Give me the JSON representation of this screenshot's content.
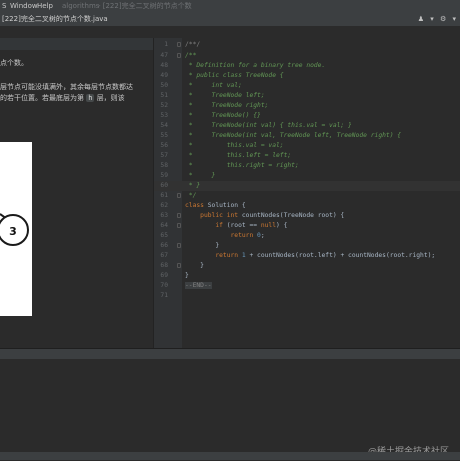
{
  "menubar": {
    "left_glyph": "S",
    "items": [
      "Window",
      "Help"
    ],
    "app_name": "algorithms",
    "window_title": "- [222]完全二叉树的节点个数"
  },
  "tabbar": {
    "file_tab": "[222]完全二叉树的节点个数.java",
    "right_icons": [
      "run-config",
      "▾",
      "⚙",
      "▾"
    ]
  },
  "left_panel": {
    "lines": [
      "点个数。",
      "层节点可能没填满外，其余每层节点数都达",
      "的若干位置。若最底层为第",
      "层，则该"
    ],
    "inline_code": "h",
    "tree_node_value": "3"
  },
  "editor": {
    "line_numbers": [
      "1",
      "47",
      "48",
      "49",
      "50",
      "51",
      "52",
      "53",
      "54",
      "55",
      "56",
      "57",
      "58",
      "59",
      "60",
      "61",
      "62",
      "63",
      "64",
      "65",
      "66",
      "67",
      "68",
      "69",
      "70",
      "71"
    ],
    "code": {
      "l1": "/**/",
      "l47": "/**",
      "l48": " * Definition for a binary tree node.",
      "l49": " * public class TreeNode {",
      "l50": " *     int val;",
      "l51": " *     TreeNode left;",
      "l52": " *     TreeNode right;",
      "l53": " *     TreeNode() {}",
      "l54": " *     TreeNode(int val) { this.val = val; }",
      "l55": " *     TreeNode(int val, TreeNode left, TreeNode right) {",
      "l56": " *         this.val = val;",
      "l57": " *         this.left = left;",
      "l58": " *         this.right = right;",
      "l59": " *     }",
      "l60": " * }",
      "l61": " */",
      "l62_kw": "class",
      "l62_rest": " Solution {",
      "l63_kw": "    public int",
      "l63_rest": " countNodes(TreeNode root) {",
      "l64_kw": "        if",
      "l64_rest": " (root == ",
      "l64_null": "null",
      "l64_end": ") {",
      "l65_kw": "            return",
      "l65_num": " 0",
      "l65_end": ";",
      "l66": "        }",
      "l67_kw": "        return",
      "l67_num": " 1",
      "l67_rest": " + countNodes(root.left) + countNodes(root.right);",
      "l68": "    }",
      "l69": "}",
      "l70": "--END--",
      "l71": ""
    }
  },
  "watermark": "@稀土掘金技术社区",
  "colors": {
    "background": "#2b2b2b",
    "comment": "#629755",
    "keyword": "#cc7832",
    "text": "#a9b7c6",
    "number": "#6897bb"
  }
}
